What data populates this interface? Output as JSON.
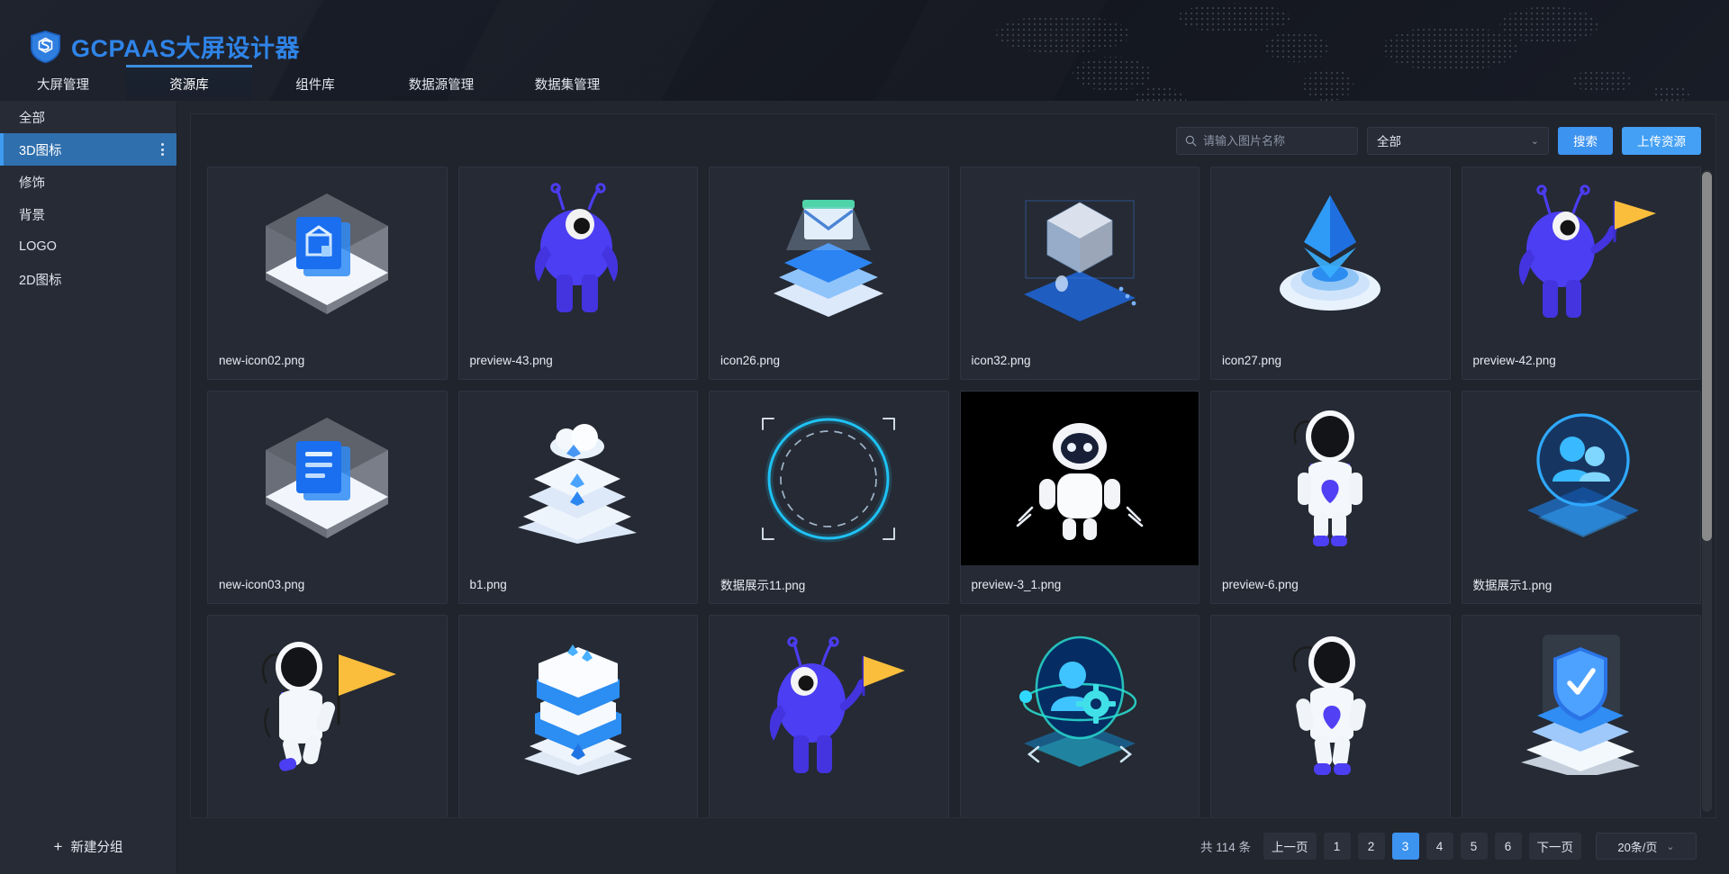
{
  "header": {
    "logo_icon": "shield-s-logo",
    "title": "GCPAAS大屏设计器",
    "brand_color": "#2f84e8"
  },
  "nav": {
    "tabs": [
      {
        "label": "大屏管理",
        "active": false
      },
      {
        "label": "资源库",
        "active": true
      },
      {
        "label": "组件库",
        "active": false
      },
      {
        "label": "数据源管理",
        "active": false
      },
      {
        "label": "数据集管理",
        "active": false
      }
    ]
  },
  "sidebar": {
    "items": [
      {
        "label": "全部",
        "active": false,
        "has_menu": false
      },
      {
        "label": "3D图标",
        "active": true,
        "has_menu": true
      },
      {
        "label": "修饰",
        "active": false,
        "has_menu": false
      },
      {
        "label": "背景",
        "active": false,
        "has_menu": false
      },
      {
        "label": "LOGO",
        "active": false,
        "has_menu": false
      },
      {
        "label": "2D图标",
        "active": false,
        "has_menu": false
      }
    ],
    "new_group_label": "新建分组",
    "new_group_icon": "plus-icon",
    "active_color": "#2f6fad"
  },
  "toolbar": {
    "search_icon": "search-icon",
    "search_placeholder": "请输入图片名称",
    "search_value": "",
    "filter_selected": "全部",
    "filter_caret_icon": "chevron-down-icon",
    "search_button": "搜索",
    "upload_button": "上传资源",
    "primary_color": "#3d93f0"
  },
  "grid": {
    "cards": [
      {
        "name": "new-icon02.png",
        "icon": "iso-cube-folder"
      },
      {
        "name": "preview-43.png",
        "icon": "alien-plain"
      },
      {
        "name": "icon26.png",
        "icon": "iso-mail-stack"
      },
      {
        "name": "icon32.png",
        "icon": "iso-cube-plane"
      },
      {
        "name": "icon27.png",
        "icon": "eth-target"
      },
      {
        "name": "preview-42.png",
        "icon": "alien-flag"
      },
      {
        "name": "new-icon03.png",
        "icon": "iso-cube-doc"
      },
      {
        "name": "b1.png",
        "icon": "iso-server-cloud"
      },
      {
        "name": "数据展示11.png",
        "icon": "neon-ring"
      },
      {
        "name": "preview-3_1.png",
        "icon": "robot-black"
      },
      {
        "name": "preview-6.png",
        "icon": "astronaut-stand"
      },
      {
        "name": "数据展示1.png",
        "icon": "users-neon-circle"
      },
      {
        "name": "",
        "icon": "astronaut-flag"
      },
      {
        "name": "",
        "icon": "iso-server-tower"
      },
      {
        "name": "",
        "icon": "alien-flag2"
      },
      {
        "name": "",
        "icon": "user-gear-neon"
      },
      {
        "name": "",
        "icon": "astronaut-walk"
      },
      {
        "name": "",
        "icon": "iso-shield-check"
      }
    ]
  },
  "pagination": {
    "total_label": "共 114 条",
    "prev_label": "上一页",
    "next_label": "下一页",
    "pages": [
      "1",
      "2",
      "3",
      "4",
      "5",
      "6"
    ],
    "current_page": "3",
    "page_size_label": "20条/页",
    "page_size_caret": "chevron-down-icon",
    "active_color": "#3d93f0"
  }
}
